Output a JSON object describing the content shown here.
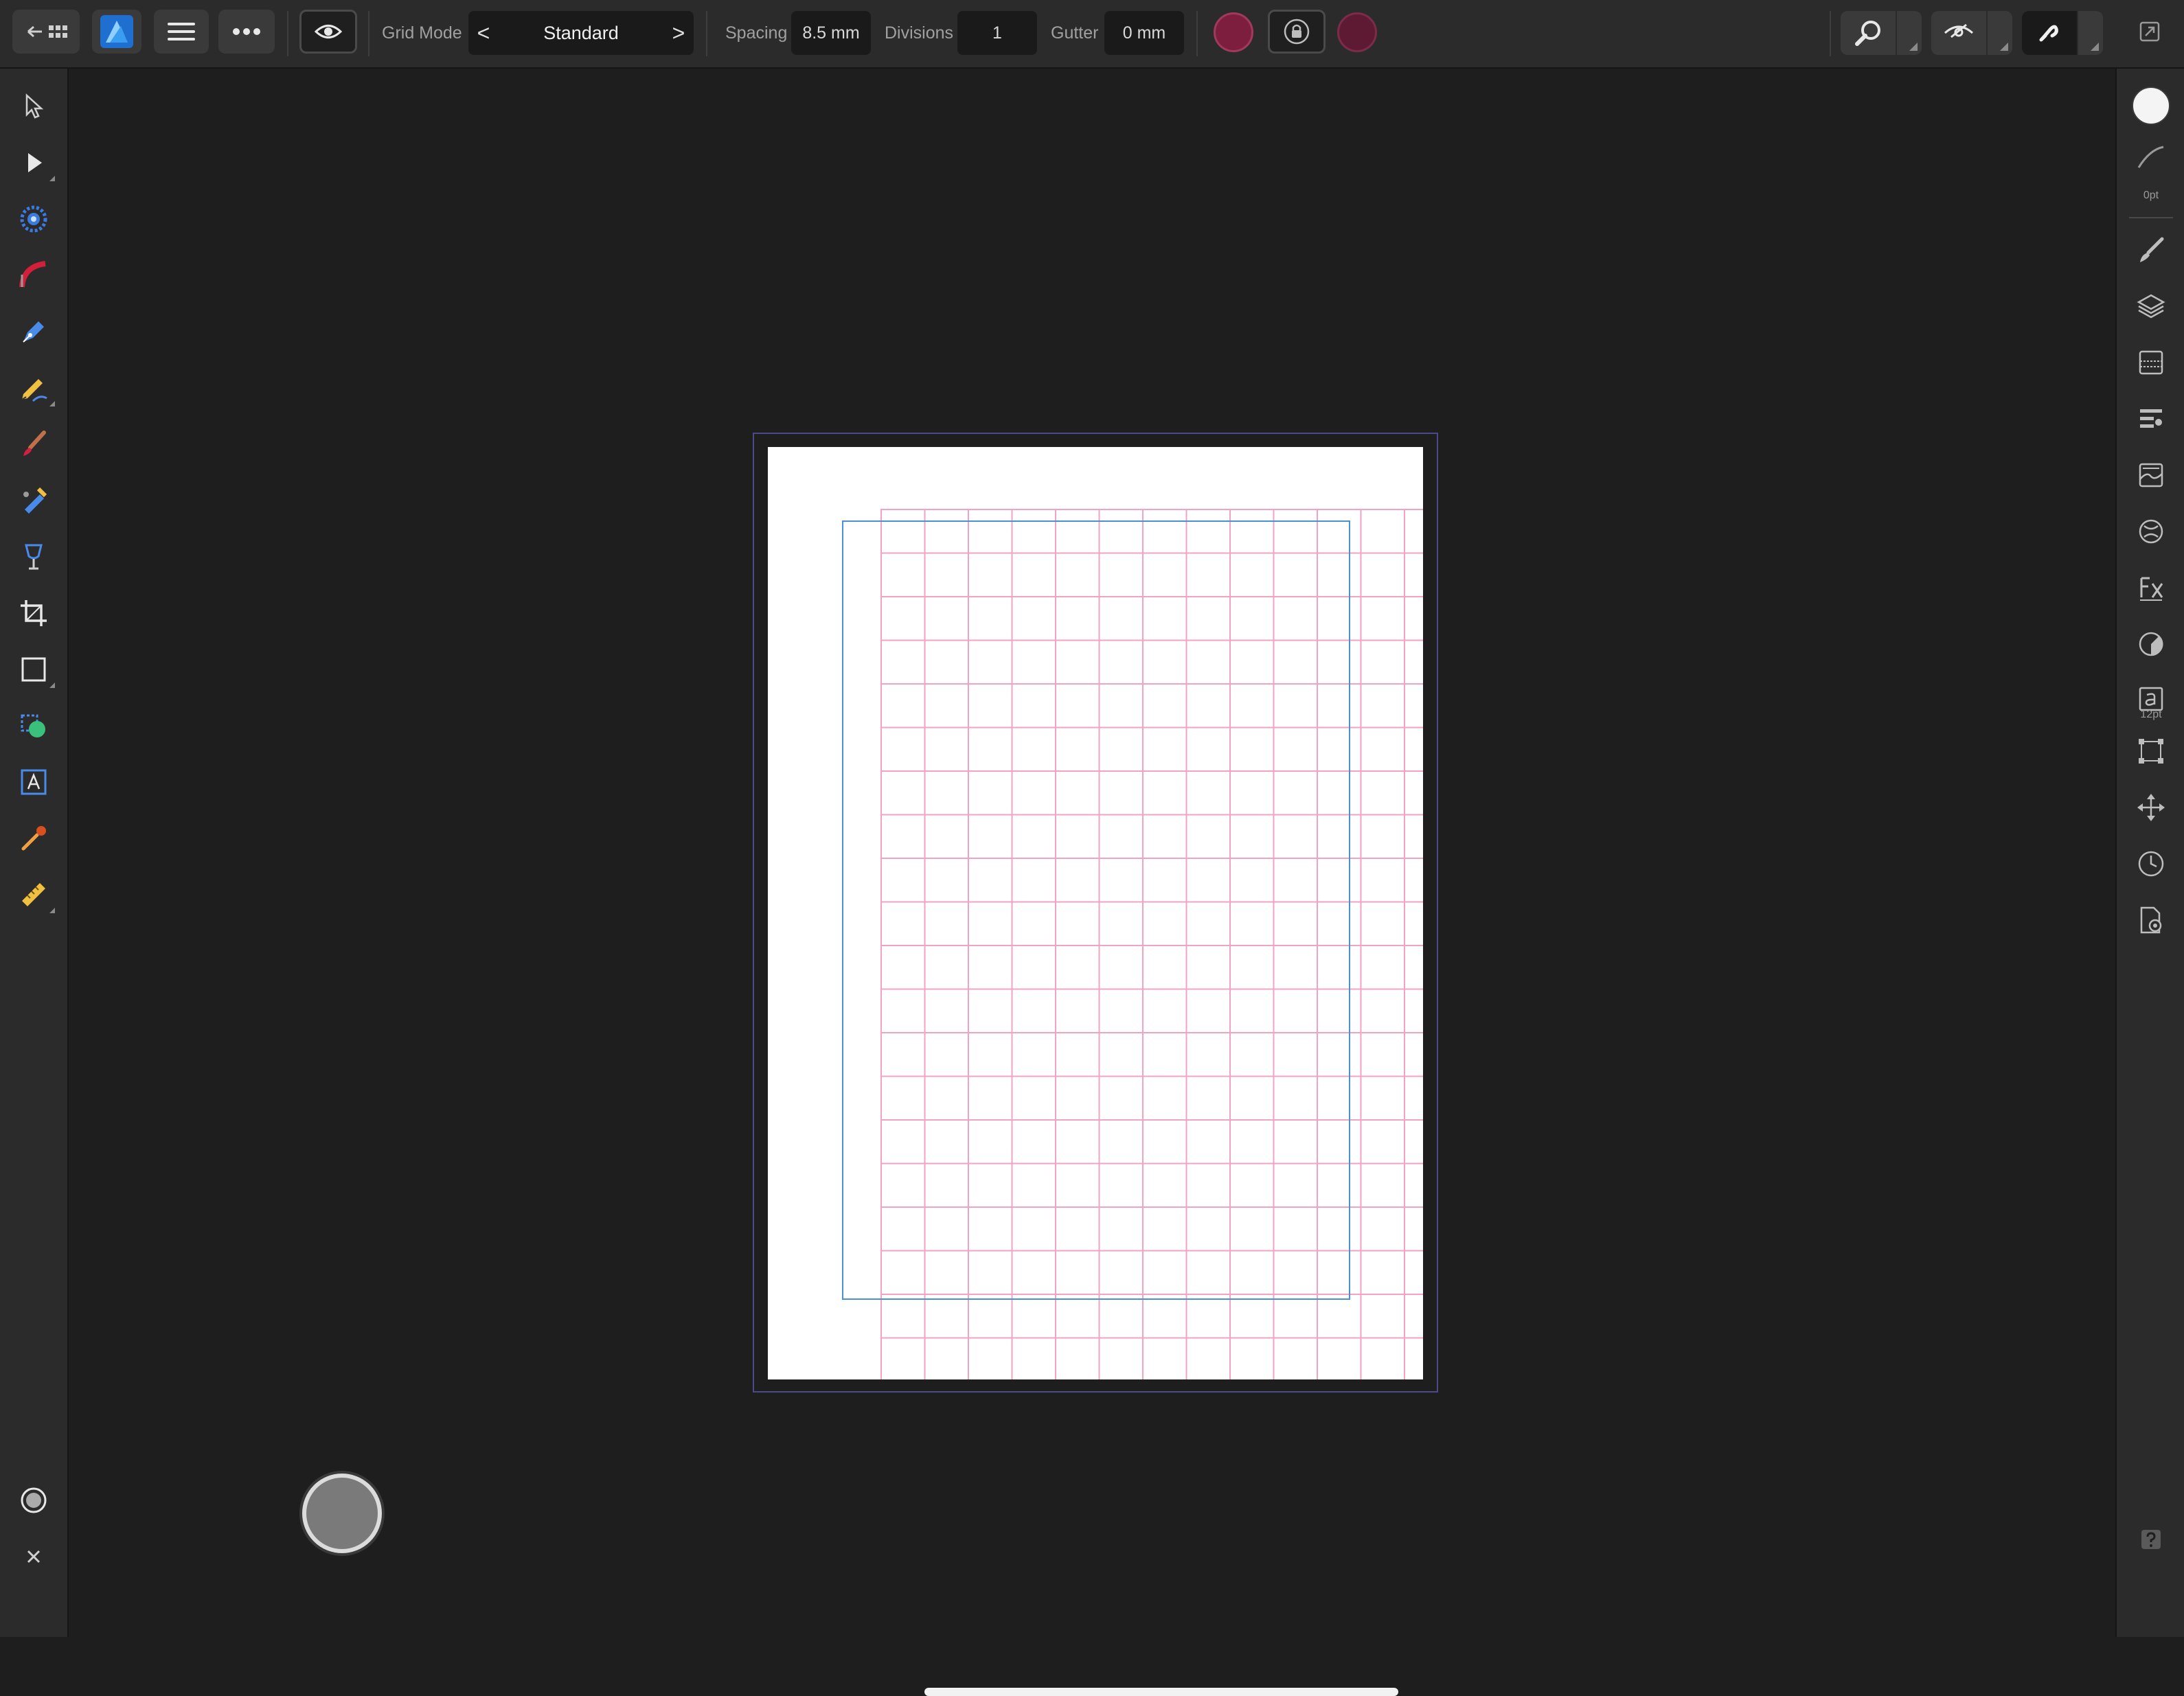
{
  "toolbar": {
    "grid_mode_label": "Grid Mode",
    "grid_mode_value": "Standard",
    "spacing_label": "Spacing",
    "spacing_value": "8.5 mm",
    "divisions_label": "Divisions",
    "divisions_value": "1",
    "gutter_label": "Gutter",
    "gutter_value": "0 mm",
    "prev_glyph": "<",
    "next_glyph": ">"
  },
  "right_panel": {
    "stroke_width": "0pt",
    "text_size": "12pt"
  },
  "colors": {
    "accent_blue": "#4a90d9",
    "grid_pink": "#f2a3c4",
    "swatch_primary": "#7e1e3e",
    "swatch_secondary": "#5e1a33"
  },
  "icons": {
    "left_tools": [
      "move-tool-icon",
      "node-tool-icon",
      "corner-tool-icon",
      "pen-tool-icon",
      "pencil-tool-icon",
      "vector-brush-icon",
      "fill-tool-icon",
      "transparency-tool-icon",
      "crop-tool-icon",
      "rectangle-tool-icon",
      "shape-builder-icon",
      "text-tool-icon",
      "color-picker-icon",
      "measure-tool-icon"
    ],
    "right_studios": [
      "color-studio-icon",
      "stroke-studio-icon",
      "brushes-studio-icon",
      "layers-studio-icon",
      "appearance-studio-icon",
      "swatches-studio-icon",
      "text-styles-studio-icon",
      "adjustments-studio-icon",
      "fx-studio-icon",
      "gradient-studio-icon",
      "character-studio-icon",
      "transform-studio-icon",
      "navigator-studio-icon",
      "history-studio-icon",
      "document-settings-icon"
    ]
  }
}
